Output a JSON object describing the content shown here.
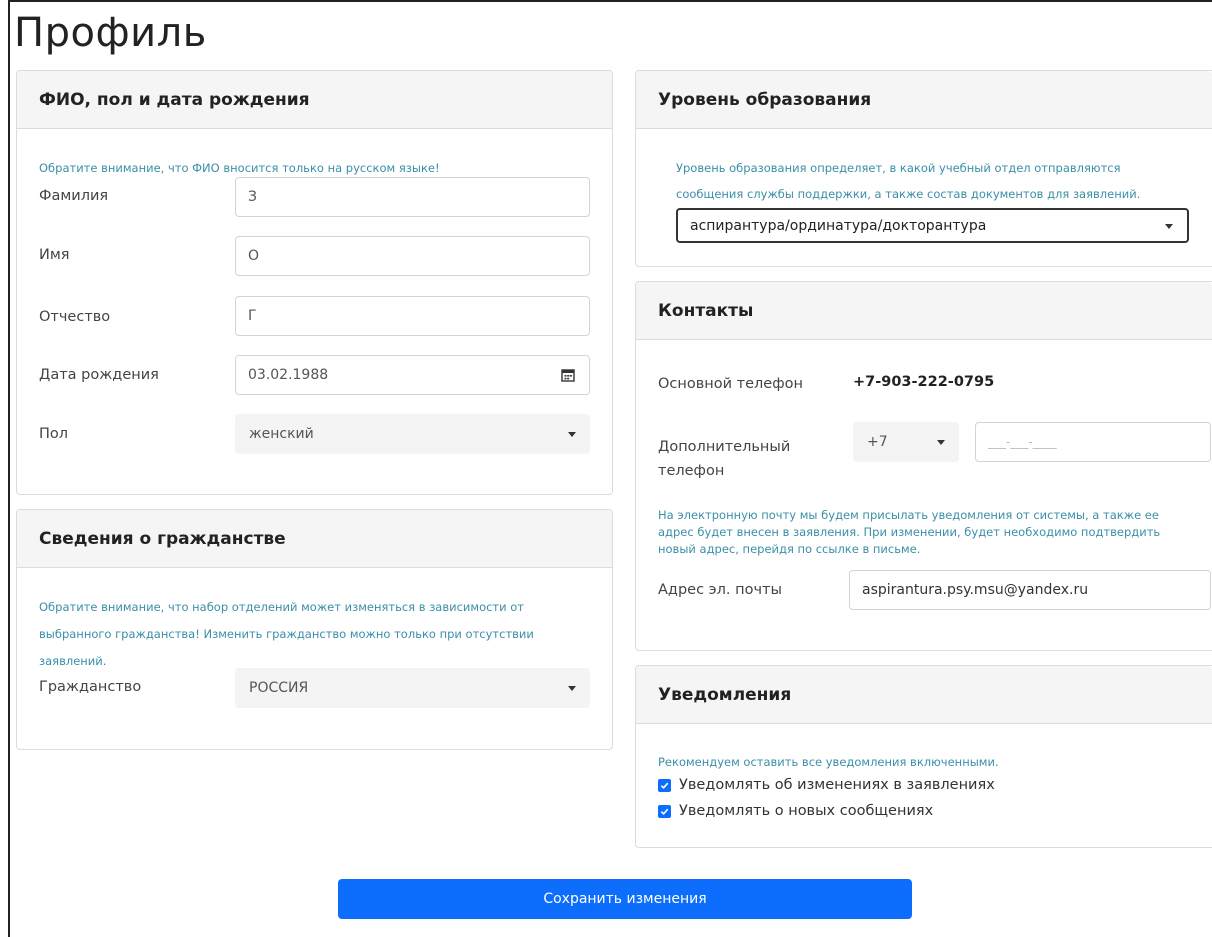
{
  "page": {
    "title": "Профиль"
  },
  "fio": {
    "header": "ФИО, пол и дата рождения",
    "note": "Обратите внимание, что ФИО вносится только на русском языке!",
    "surname_label": "Фамилия",
    "surname_value": "З",
    "name_label": "Имя",
    "name_value": "О",
    "patronymic_label": "Отчество",
    "patronymic_value": "Г",
    "birthdate_label": "Дата рождения",
    "birthdate_value": "03.02.1988",
    "gender_label": "Пол",
    "gender_value": "женский"
  },
  "citizenship": {
    "header": "Сведения о гражданстве",
    "note": "Обратите внимание, что набор отделений может изменяться в зависимости от выбранного гражданства! Изменить гражданство можно только при отсутствии заявлений.",
    "label": "Гражданство",
    "value": "РОССИЯ"
  },
  "education": {
    "header": "Уровень образования",
    "note": "Уровень образования определяет, в какой учебный отдел отправляются сообщения службы поддержки, а также состав документов для заявлений.",
    "value": "аспирантура/ординатура/докторантура"
  },
  "contacts": {
    "header": "Контакты",
    "main_phone_label": "Основной телефон",
    "main_phone_value": "+7-903-222-0795",
    "extra_phone_label": "Дополнительный телефон",
    "extra_phone_code": "+7",
    "extra_phone_placeholder": "___-___-____",
    "email_note": "На электронную почту мы будем присылать уведомления от системы, а также ее адрес будет внесен в заявления. При изменении, будет необходимо подтвердить новый адрес, перейдя по ссылке в письме.",
    "email_label": "Адрес эл. почты",
    "email_value": "aspirantura.psy.msu@yandex.ru"
  },
  "notifications": {
    "header": "Уведомления",
    "note": "Рекомендуем оставить все уведомления включенными.",
    "items": [
      {
        "label": "Уведомлять об изменениях в заявлениях",
        "checked": true
      },
      {
        "label": "Уведомлять о новых сообщениях",
        "checked": true
      }
    ]
  },
  "actions": {
    "save_label": "Сохранить изменения"
  },
  "colors": {
    "accent": "#0d6efd",
    "note_text": "#3a8fa8"
  },
  "icons": {
    "date": "calendar-icon",
    "dropdown": "chevron-down-icon",
    "check": "checkmark-icon"
  }
}
